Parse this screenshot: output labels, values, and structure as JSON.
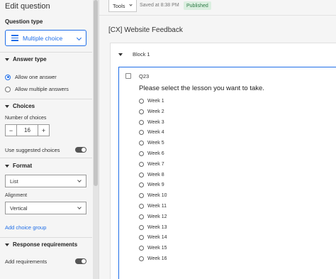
{
  "left_panel": {
    "title": "Edit question",
    "question_type_label": "Question type",
    "question_type_value": "Multiple choice",
    "answer_type_heading": "Answer type",
    "answer_options": [
      "Allow one answer",
      "Allow multiple answers"
    ],
    "choices_heading": "Choices",
    "number_of_choices_label": "Number of choices",
    "number_of_choices_value": "16",
    "stepper_minus": "−",
    "stepper_plus": "+",
    "use_suggested_label": "Use suggested choices",
    "format_heading": "Format",
    "format_value": "List",
    "alignment_label": "Alignment",
    "alignment_value": "Vertical",
    "add_choice_group": "Add choice group",
    "response_requirements_heading": "Response requirements",
    "add_requirements_label": "Add requirements"
  },
  "toolbar": {
    "tools_label": "Tools",
    "saved_text": "Saved at 8:38 PM",
    "status_badge": "Published"
  },
  "survey": {
    "title": "[CX] Website Feedback",
    "block_label": "Block 1",
    "question": {
      "id": "Q23",
      "text": "Please select the lesson you want to take.",
      "choices": [
        "Week 1",
        "Week 2",
        "Week 3",
        "Week 4",
        "Week 5",
        "Week 6",
        "Week 7",
        "Week 8",
        "Week 9",
        "Week 10",
        "Week 11",
        "Week 12",
        "Week 13",
        "Week 14",
        "Week 15",
        "Week 16"
      ]
    }
  },
  "colors": {
    "accent": "#1f6ee8",
    "published_bg": "#dbefe0",
    "published_text": "#2d7a45"
  }
}
